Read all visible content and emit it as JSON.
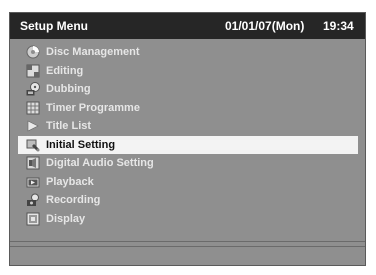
{
  "header": {
    "title": "Setup Menu",
    "date": "01/01/07(Mon)",
    "time": "19:34"
  },
  "menu": {
    "items": [
      {
        "label": "Disc Management",
        "icon": "disc-icon"
      },
      {
        "label": "Editing",
        "icon": "editing-icon"
      },
      {
        "label": "Dubbing",
        "icon": "dubbing-icon"
      },
      {
        "label": "Timer Programme",
        "icon": "timer-icon"
      },
      {
        "label": "Title List",
        "icon": "title-list-icon"
      },
      {
        "label": "Initial Setting",
        "icon": "initial-setting-icon",
        "selected": true
      },
      {
        "label": "Digital Audio Setting",
        "icon": "digital-audio-icon"
      },
      {
        "label": "Playback",
        "icon": "playback-icon"
      },
      {
        "label": "Recording",
        "icon": "recording-icon"
      },
      {
        "label": "Display",
        "icon": "display-icon"
      }
    ]
  },
  "colors": {
    "background": "#8f8f8f",
    "titlebar": "#262626",
    "highlight": "#f3f3f3",
    "text": "#e6e6e6"
  }
}
